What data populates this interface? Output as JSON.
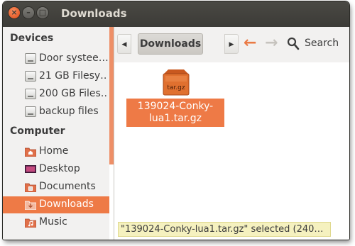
{
  "window": {
    "title": "Downloads"
  },
  "sidebar": {
    "devices_heading": "Devices",
    "devices": [
      {
        "label": "Door systee…",
        "icon": "drive-icon"
      },
      {
        "label": "21 GB Filesy…",
        "icon": "drive-icon"
      },
      {
        "label": "200 GB Files…",
        "icon": "drive-icon"
      },
      {
        "label": "backup files",
        "icon": "drive-icon"
      }
    ],
    "computer_heading": "Computer",
    "places": [
      {
        "label": "Home",
        "icon": "home-folder-icon"
      },
      {
        "label": "Desktop",
        "icon": "desktop-icon"
      },
      {
        "label": "Documents",
        "icon": "documents-folder-icon"
      },
      {
        "label": "Downloads",
        "icon": "downloads-folder-icon",
        "selected": true
      },
      {
        "label": "Music",
        "icon": "music-folder-icon"
      }
    ]
  },
  "toolbar": {
    "breadcrumb": "Downloads",
    "search_label": "Search"
  },
  "content": {
    "files": [
      {
        "name": "139024-Conky-lua1.tar.gz",
        "icon_text": "tar.gz",
        "selected": true
      }
    ]
  },
  "statusbar": {
    "text": "\"139024-Conky-lua1.tar.gz\" selected (240…"
  },
  "colors": {
    "accent": "#ee7a46",
    "titlebar": "#3c3b37",
    "sidebar": "#f2f1f0",
    "status_bg": "#f5f1bf"
  }
}
